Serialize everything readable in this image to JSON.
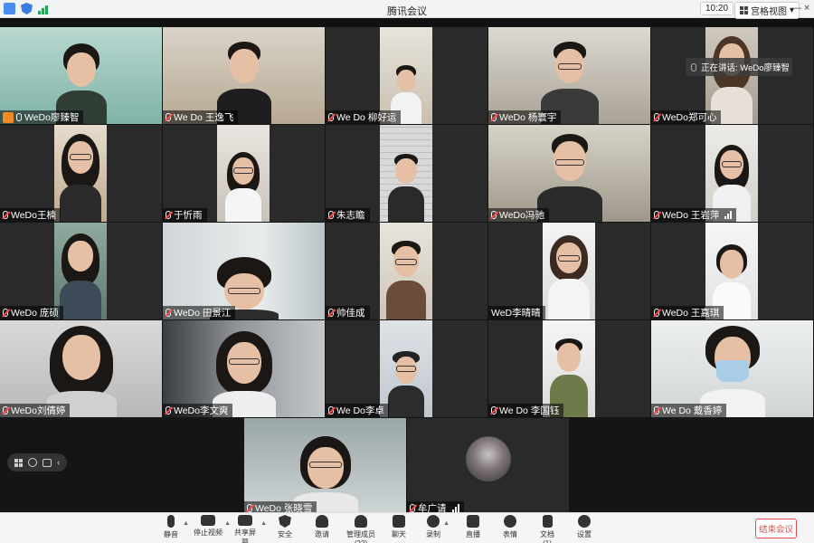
{
  "titlebar": {
    "title": "腾讯会议",
    "time": "10:20",
    "view_label": "宫格视图",
    "view_caret": "▾",
    "minimize": "—",
    "close": "×"
  },
  "speaking": {
    "text": "正在讲话: WeDo廖臻智"
  },
  "tiles": [
    {
      "name": "WeDo廖臻智",
      "host": true,
      "muted": false
    },
    {
      "name": "We Do 王逸飞",
      "muted": true
    },
    {
      "name": "We Do 柳好运",
      "muted": true
    },
    {
      "name": "WeDo 杨寰宇",
      "muted": true
    },
    {
      "name": "WeDo郑可心",
      "muted": true
    },
    {
      "name": "WeDo王楠",
      "muted": true
    },
    {
      "name": "于忻雨",
      "muted": true
    },
    {
      "name": "朱志瞻",
      "muted": true
    },
    {
      "name": "WeDo冯驰",
      "muted": true
    },
    {
      "name": "WeDo 王岩萍",
      "muted": true,
      "signal": true
    },
    {
      "name": "WeDo 庞硕",
      "muted": true
    },
    {
      "name": "WeDo 田景江",
      "muted": true
    },
    {
      "name": "帅佳成",
      "muted": true
    },
    {
      "name": "WeD李晴晴",
      "muted": false,
      "nomic": true
    },
    {
      "name": "WeDo 王嘉琪",
      "muted": true
    },
    {
      "name": "WeDo刘倩婷",
      "muted": true
    },
    {
      "name": "WeDo李文爽",
      "muted": true
    },
    {
      "name": "We Do李卓",
      "muted": true
    },
    {
      "name": "We Do 李国钰",
      "muted": true
    },
    {
      "name": "We Do 戴香婷",
      "muted": true
    },
    {
      "name": "WeDo 张晓雪",
      "muted": true
    },
    {
      "name": "牟广请",
      "muted": true,
      "signal": true
    }
  ],
  "toolbar": {
    "mute": "静音",
    "stop_video": "停止视频",
    "share": "共享屏幕",
    "security": "安全",
    "invite": "邀请",
    "members": "管理成员(22)",
    "chat": "聊天",
    "record": "录制",
    "live": "直播",
    "reactions": "表情",
    "docs": "文档(1)",
    "settings": "设置",
    "end": "结束会议"
  },
  "side_tools": {
    "more": "‹"
  },
  "colors": {
    "accent_orange": "#f08a24",
    "end_red": "#e34d4d",
    "mute_red": "#ff4a4a"
  }
}
